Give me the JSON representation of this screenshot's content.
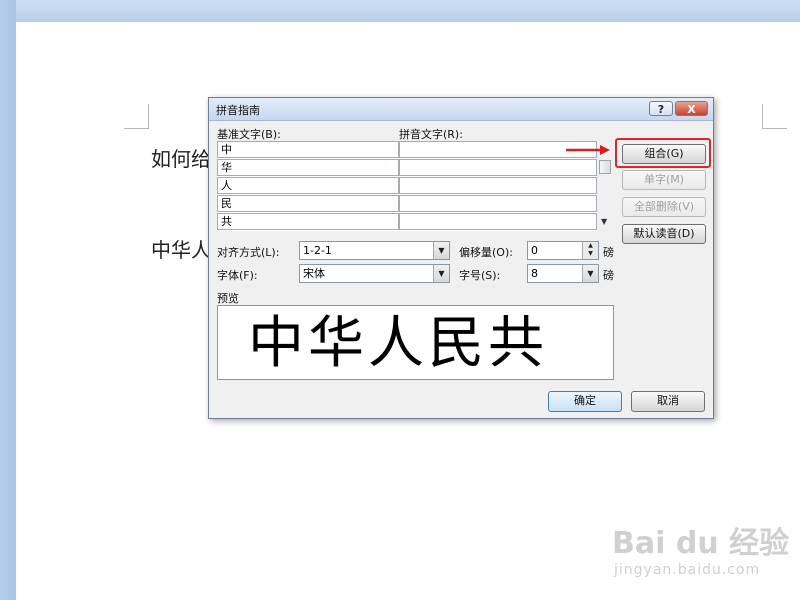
{
  "document": {
    "line1": "如何给",
    "line2": "中华人"
  },
  "dialog": {
    "title": "拼音指南",
    "help_label": "?",
    "close_label": "X",
    "base_text_label": "基准文字(B):",
    "ruby_text_label": "拼音文字(R):",
    "rows": [
      {
        "base": "中",
        "ruby": ""
      },
      {
        "base": "华",
        "ruby": ""
      },
      {
        "base": "人",
        "ruby": ""
      },
      {
        "base": "民",
        "ruby": ""
      },
      {
        "base": "共",
        "ruby": ""
      }
    ],
    "buttons": {
      "group": "组合(G)",
      "mono": "单字(M)",
      "clear_all": "全部删除(V)",
      "default_reading": "默认读音(D)",
      "ok": "确定",
      "cancel": "取消"
    },
    "alignment": {
      "label": "对齐方式(L):",
      "value": "1-2-1"
    },
    "offset": {
      "label": "偏移量(O):",
      "value": "0",
      "unit": "磅"
    },
    "font": {
      "label": "字体(F):",
      "value": "宋体"
    },
    "size": {
      "label": "字号(S):",
      "value": "8",
      "unit": "磅"
    },
    "preview_label": "预览",
    "preview_text": "中华人民共"
  },
  "watermark": {
    "logo": "Bai du 经验",
    "url": "jingyan.baidu.com"
  },
  "colors": {
    "highlight": "#e0242c",
    "arrow": "#d81e1e"
  }
}
